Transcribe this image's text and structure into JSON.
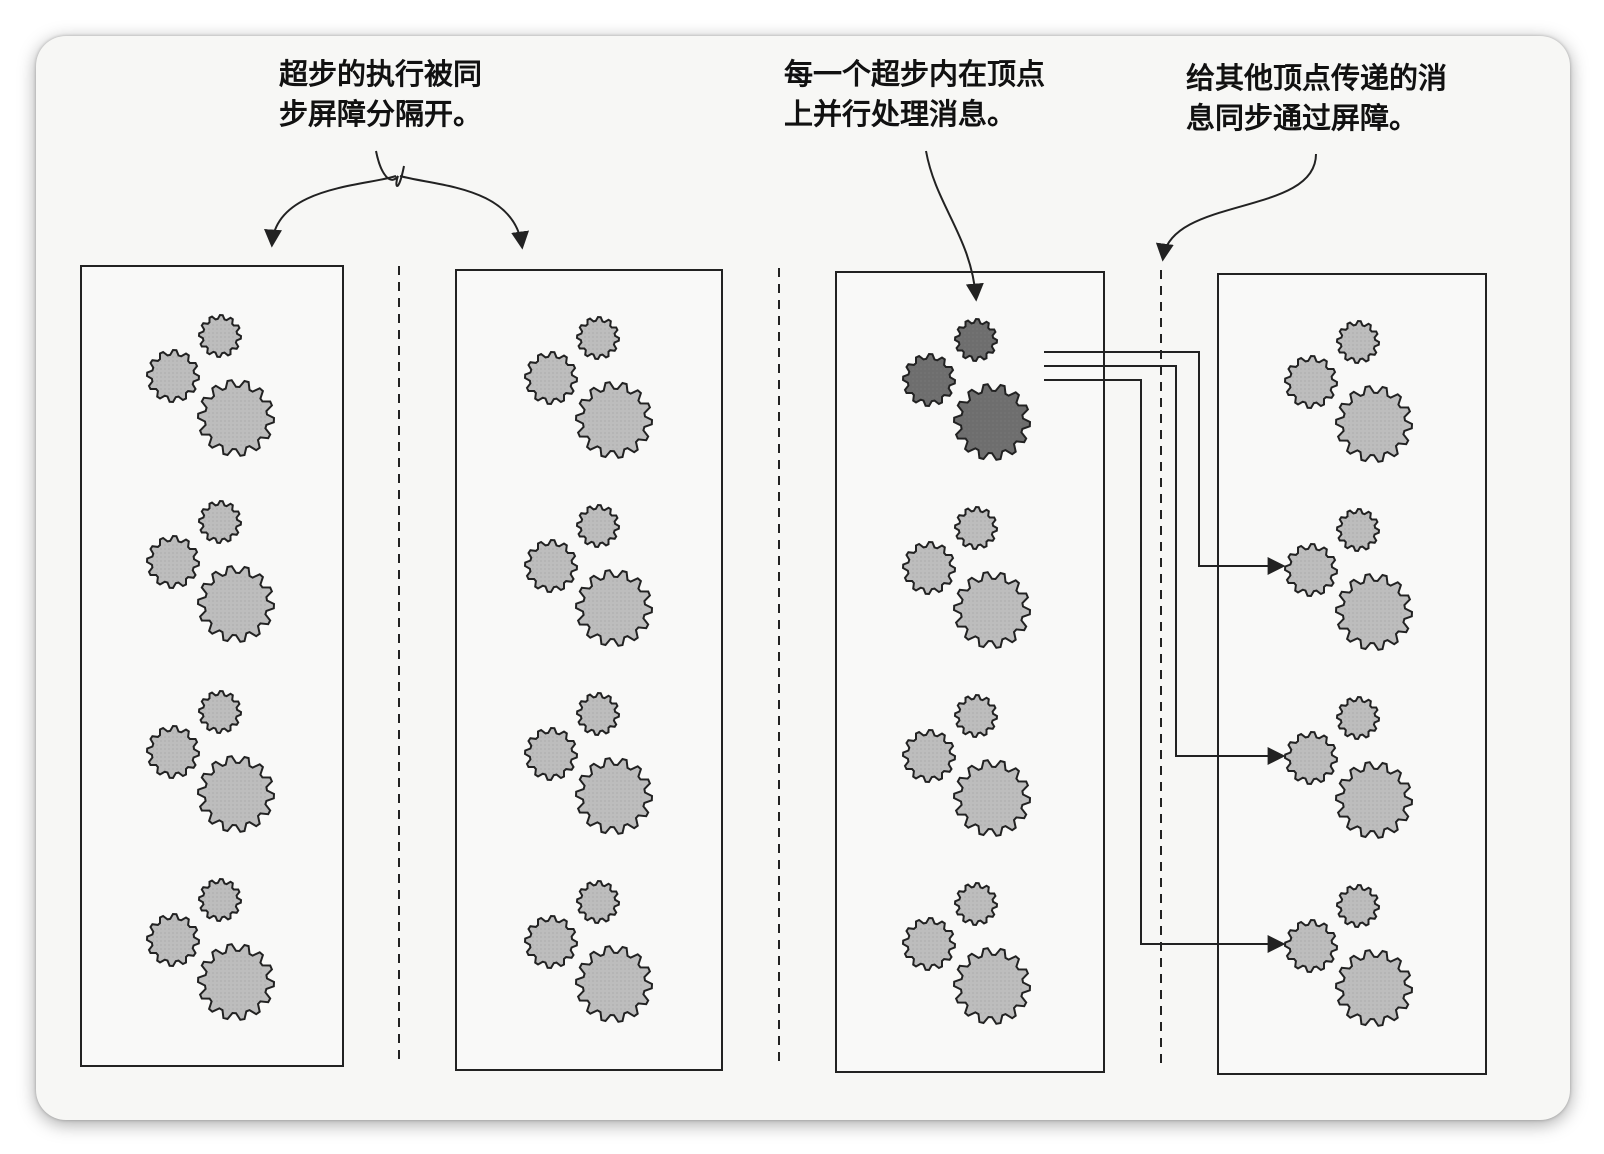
{
  "callouts": {
    "barrier_note": {
      "line1": "超步的执行被同",
      "line2": "步屏障分隔开。"
    },
    "parallel_note": {
      "line1": "每一个超步内在顶点",
      "line2": "上并行处理消息。"
    },
    "message_note": {
      "line1": "给其他顶点传递的消",
      "line2": "息同步通过屏障。"
    }
  },
  "colors": {
    "gear_fill": "#bdbdbd",
    "gear_fill_active": "#6e6e6e",
    "stroke": "#222222",
    "background": "#f7f7f5"
  },
  "icons": [
    "gear-icon",
    "arrow-icon",
    "brace-icon"
  ]
}
